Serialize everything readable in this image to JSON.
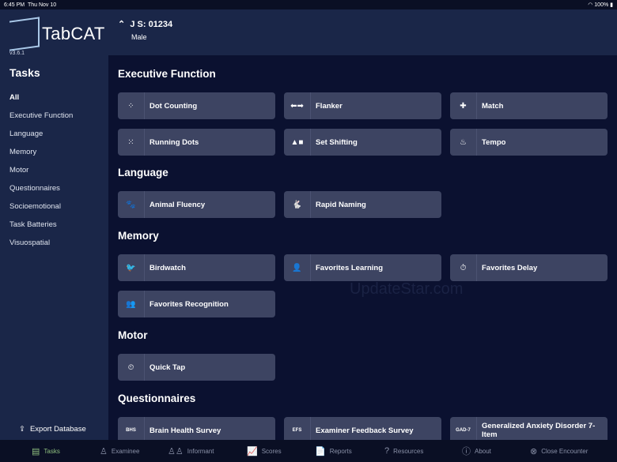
{
  "status": {
    "time": "6:45 PM",
    "date": "Thu Nov 10",
    "battery": "100%"
  },
  "app": {
    "name": "TabCAT",
    "version": "v3.6.1"
  },
  "sidebar": {
    "title": "Tasks",
    "items": [
      "All",
      "Executive Function",
      "Language",
      "Memory",
      "Motor",
      "Questionnaires",
      "Socioemotional",
      "Task Batteries",
      "Visuospatial"
    ],
    "export": "Export Database"
  },
  "patient": {
    "id": "J S: 01234",
    "sex": "Male"
  },
  "sections": [
    {
      "title": "Executive Function",
      "tasks": [
        {
          "label": "Dot Counting",
          "icon": "⁘"
        },
        {
          "label": "Flanker",
          "icon": "⬅➡"
        },
        {
          "label": "Match",
          "icon": "✚"
        },
        {
          "label": "Running Dots",
          "icon": "⁙"
        },
        {
          "label": "Set Shifting",
          "icon": "▲■"
        },
        {
          "label": "Tempo",
          "icon": "♨"
        }
      ]
    },
    {
      "title": "Language",
      "tasks": [
        {
          "label": "Animal Fluency",
          "icon": "🐾"
        },
        {
          "label": "Rapid Naming",
          "icon": "🐇"
        }
      ]
    },
    {
      "title": "Memory",
      "tasks": [
        {
          "label": "Birdwatch",
          "icon": "🐦"
        },
        {
          "label": "Favorites Learning",
          "icon": "👤"
        },
        {
          "label": "Favorites Delay",
          "icon": "⏱"
        },
        {
          "label": "Favorites Recognition",
          "icon": "👥"
        }
      ]
    },
    {
      "title": "Motor",
      "tasks": [
        {
          "label": "Quick Tap",
          "icon": "⏲"
        }
      ]
    },
    {
      "title": "Questionnaires",
      "tasks": [
        {
          "label": "Brain Health Survey",
          "icon": "BHS"
        },
        {
          "label": "Examiner Feedback Survey",
          "icon": "EFS"
        },
        {
          "label": "Generalized Anxiety Disorder 7-Item",
          "icon": "GAD-7"
        }
      ]
    }
  ],
  "tabs": [
    {
      "label": "Tasks",
      "icon": "▤"
    },
    {
      "label": "Examinee",
      "icon": "♙"
    },
    {
      "label": "Informant",
      "icon": "♙♙"
    },
    {
      "label": "Scores",
      "icon": "📈"
    },
    {
      "label": "Reports",
      "icon": "📄"
    },
    {
      "label": "Resources",
      "icon": "?"
    },
    {
      "label": "About",
      "icon": "ⓘ"
    },
    {
      "label": "Close Encounter",
      "icon": "⊗"
    }
  ],
  "watermark": "UpdateStar.com"
}
